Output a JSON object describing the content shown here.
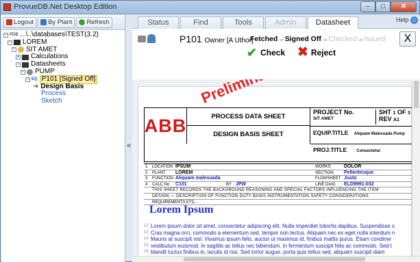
{
  "window": {
    "title": "ProvueDB.Net Desktop Edition"
  },
  "toolbar": {
    "logout": "Logout",
    "by_plant": "By Plant",
    "refresh": "Refresh"
  },
  "tree": {
    "root": "...\\..\\databases\\TEST(3.2)",
    "root_tag": "PDB",
    "items": [
      {
        "label": "LOREM",
        "level": 1,
        "box": "−"
      },
      {
        "label": "SIT AMET",
        "level": 2,
        "box": "−"
      },
      {
        "label": "Calculations",
        "level": 3,
        "box": "+"
      },
      {
        "label": "Datasheets",
        "level": 3,
        "box": "−"
      },
      {
        "label": "PUMP",
        "level": 4,
        "box": "−"
      },
      {
        "label": "P101 [Signed Off]",
        "level": 5,
        "box": "−",
        "tag": "EQ",
        "selected": true
      },
      {
        "label": "Design Basis",
        "level": 6,
        "current": true
      },
      {
        "label": "Process",
        "level": 6
      },
      {
        "label": "Sketch",
        "level": 6
      }
    ]
  },
  "tabs": [
    {
      "label": "Status",
      "enabled": true
    },
    {
      "label": "Find",
      "enabled": true
    },
    {
      "label": "Tools",
      "enabled": true
    },
    {
      "label": "Admin",
      "enabled": false
    },
    {
      "label": "Datasheet",
      "enabled": true,
      "active": true
    }
  ],
  "help": "Help",
  "header": {
    "item_id": "P101",
    "owner": "Owner [A Uthor]",
    "states": [
      {
        "label": "Fetched",
        "done": true
      },
      {
        "label": "Signed Off",
        "done": true
      },
      {
        "label": "Checked",
        "done": false
      },
      {
        "label": "Issued",
        "done": false
      }
    ],
    "arrow": "→",
    "close": "X",
    "check": "Check",
    "reject": "Reject"
  },
  "datasheet": {
    "logo": "ABB",
    "watermark": "Preliminary",
    "title1": "PROCESS DATA SHEET",
    "title2": "DESIGN BASIS SHEET",
    "project_no_label": "PROJECT No.",
    "project_no_value": "SIT AMET",
    "sht_label": "SHT",
    "sht_value": "1",
    "of_label": "OF",
    "of_value": "3",
    "rev_label": "REV",
    "rev_value": "A1",
    "equip_label": "EQUIP.TITLE",
    "equip_value": "Aliquam Malesuada Pump",
    "proj_title_label": "PROJ.TITLE",
    "proj_title_value": "Consectetur",
    "rows": [
      {
        "n": "1",
        "l1": "LOCATION",
        "v1": "IPSUM",
        "l2": "WORKS",
        "v2": "DOLOR"
      },
      {
        "n": "2",
        "l1": "PLANT",
        "v1": "LOREM",
        "l2": "SECTION",
        "v2": "Pellentesque"
      },
      {
        "n": "3",
        "l1": "FUNCTION",
        "v1": "Aliquam malesuada",
        "l2": "FLOWSHEET",
        "v2": "Justo"
      },
      {
        "n": "4",
        "l1": "CALC No",
        "v1": "C101",
        "by": "BY",
        "byv": "JPW",
        "l2": "LINE DIAG",
        "v2": "ELD9991-032"
      }
    ],
    "req_lines": [
      "THIS SHEET RECORDS THE BACKGROUND REASONING AND SPECIAL FACTORS INFLUENCING THE ITEM",
      "DESIGN — DESCRIPTION OF FUNCTION DUTY BASIS INSTRUMENTATION SAFETY CONSIDERATIONS",
      "REQUIREMENTS ETC..."
    ],
    "heading": "Lorem Ipsum",
    "para_lines": [
      "Lorem ipsum dolor sit amet, consectetur adipiscing elit. Nulla imperdiet lobortis dapibus. Suspendisse s",
      "Cras magna orci, commodo a elementum sed, tempor non lectus. Aliquam nec ex eget nulla interdum n",
      "Mauris at suscipit nisl. Vivamus ipsum felis, auctor ut maximus id, finibus mattis purus. Etiam condime",
      "vestibulum euismod. In sagittis ac tellus nec bibendum. In fermentum suscipit felis ac commodo. Sed t",
      "blandit luctus finibus in, iaculis id nisi. Sed tortor augue, porta quis tellus sed, aliquam suscipit diam"
    ],
    "para_nums": [
      "12",
      "13",
      "14",
      "15",
      "16"
    ]
  },
  "colors": {
    "accent": "#2e7d32",
    "reject": "#d3221b",
    "brand": "#d0191b",
    "doc_text": "#1a1fb0"
  }
}
